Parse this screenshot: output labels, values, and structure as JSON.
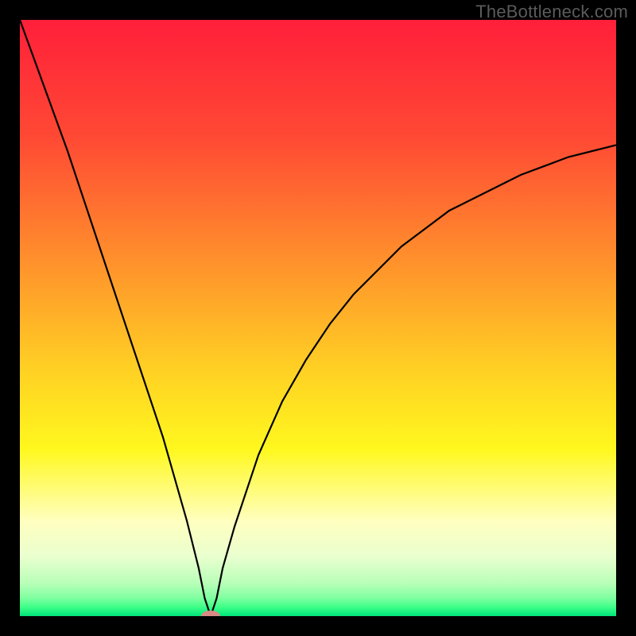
{
  "watermark": "TheBottleneck.com",
  "chart_data": {
    "type": "line",
    "title": "",
    "xlabel": "",
    "ylabel": "",
    "x_range": [
      0,
      100
    ],
    "y_range": [
      0,
      100
    ],
    "minimum_x": 32,
    "series": [
      {
        "name": "curve",
        "x": [
          0,
          4,
          8,
          12,
          16,
          20,
          24,
          28,
          30,
          31,
          32,
          33,
          34,
          36,
          40,
          44,
          48,
          52,
          56,
          60,
          64,
          68,
          72,
          76,
          80,
          84,
          88,
          92,
          96,
          100
        ],
        "y": [
          100,
          89,
          78,
          66,
          54,
          42,
          30,
          16,
          8,
          3,
          0,
          3,
          8,
          15,
          27,
          36,
          43,
          49,
          54,
          58,
          62,
          65,
          68,
          70,
          72,
          74,
          75.5,
          77,
          78,
          79
        ]
      }
    ],
    "marker": {
      "x": 32,
      "y": 0,
      "color": "#d98a84",
      "rx": 12,
      "ry": 7
    },
    "gradient_stops": [
      {
        "offset": 0.0,
        "color": "#ff1f3a"
      },
      {
        "offset": 0.2,
        "color": "#ff4a34"
      },
      {
        "offset": 0.4,
        "color": "#ff8f2c"
      },
      {
        "offset": 0.58,
        "color": "#ffce24"
      },
      {
        "offset": 0.72,
        "color": "#fff81e"
      },
      {
        "offset": 0.84,
        "color": "#ffffbf"
      },
      {
        "offset": 0.9,
        "color": "#eaffcf"
      },
      {
        "offset": 0.945,
        "color": "#b8ffb8"
      },
      {
        "offset": 0.97,
        "color": "#7effa0"
      },
      {
        "offset": 0.985,
        "color": "#3dff88"
      },
      {
        "offset": 1.0,
        "color": "#00e47a"
      }
    ]
  }
}
